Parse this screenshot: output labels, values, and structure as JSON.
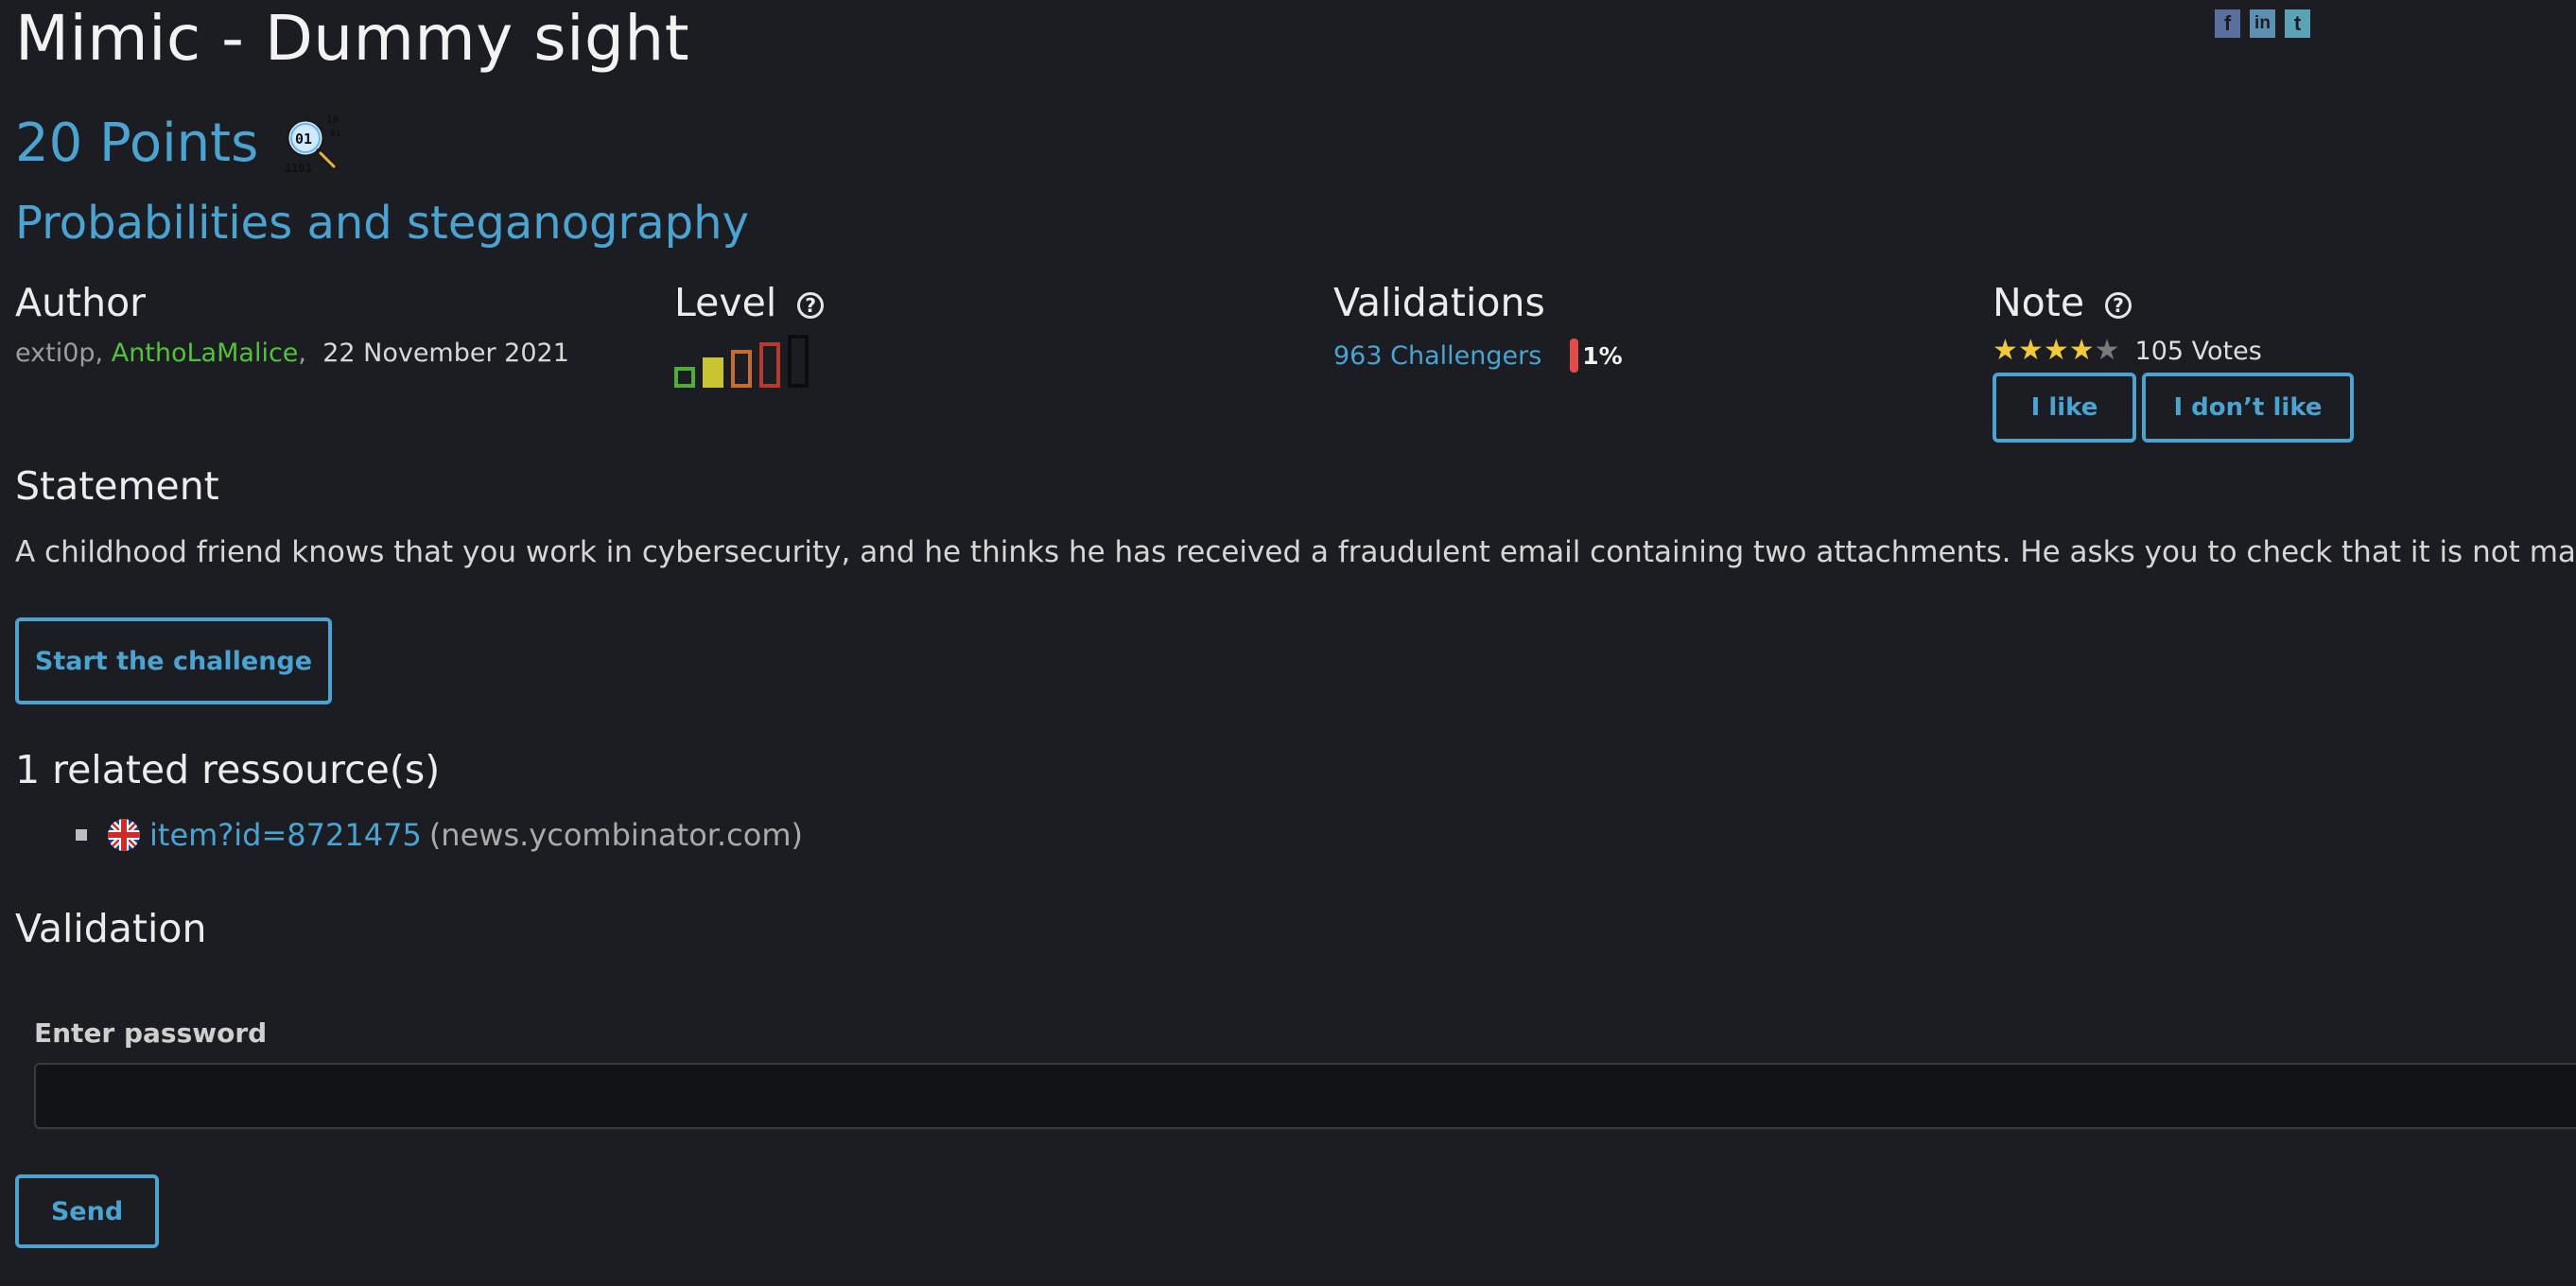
{
  "challenge": {
    "title": "Mimic - Dummy sight",
    "points": "20 Points",
    "category": "Probabilities and steganography",
    "category_icon": "steganography-magnifier-icon"
  },
  "social": {
    "facebook": "f",
    "linkedin": "in",
    "twitter": "t"
  },
  "author": {
    "heading": "Author",
    "names": [
      "exti0p",
      "AnthoLaMalice"
    ],
    "separator": ",",
    "date": "22 November 2021"
  },
  "level": {
    "heading": "Level",
    "help": "?",
    "current_level": 2,
    "max_level": 5,
    "colors": [
      "#4caf3a",
      "#c9c431",
      "#c86b2e",
      "#b8392e",
      "#0d0d0d"
    ]
  },
  "validations": {
    "heading": "Validations",
    "challengers": "963 Challengers",
    "percent": "1%",
    "percent_value": 1
  },
  "note": {
    "heading": "Note",
    "help": "?",
    "stars": 4,
    "max_stars": 5,
    "votes": "105 Votes",
    "like_label": "I like",
    "dislike_label": "I don’t like"
  },
  "statement": {
    "heading": "Statement",
    "text": "A childhood friend knows that you work in cybersecurity, and he thinks he has received a fraudulent email containing two attachments. He asks you to check that it is not malicious."
  },
  "start_button": "Start the challenge",
  "resources": {
    "heading": "1 related ressource(s)",
    "items": [
      {
        "flag": "uk-flag-icon",
        "link": "item?id=8721475",
        "domain": "(news.ycombinator.com)"
      }
    ]
  },
  "validation": {
    "heading": "Validation",
    "password_label": "Enter password",
    "password_value": "",
    "send_label": "Send"
  },
  "colors": {
    "background": "#1c1d22",
    "accent": "#4aa3d0",
    "author_highlight": "#52c23c",
    "star": "#f0c93c",
    "percent_bar": "#e24b4b"
  }
}
